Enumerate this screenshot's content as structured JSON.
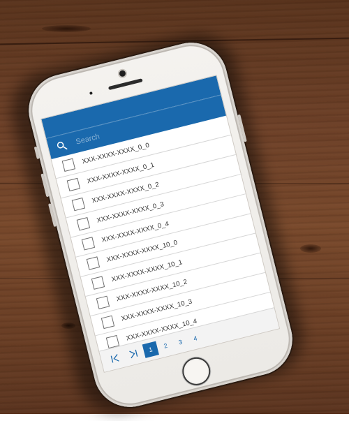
{
  "search": {
    "placeholder": "Search",
    "value": ""
  },
  "list": {
    "items": [
      {
        "label": "XXX-XXXX-XXXX_0_0",
        "checked": false
      },
      {
        "label": "XXX-XXXX-XXXX_0_1",
        "checked": false
      },
      {
        "label": "XXX-XXXX-XXXX_0_2",
        "checked": false
      },
      {
        "label": "XXX-XXXX-XXXX_0_3",
        "checked": false
      },
      {
        "label": "XXX-XXXX-XXXX_0_4",
        "checked": false
      },
      {
        "label": "XXX-XXXX-XXXX_10_0",
        "checked": false
      },
      {
        "label": "XXX-XXXX-XXXX_10_1",
        "checked": false
      },
      {
        "label": "XXX-XXXX-XXXX_10_2",
        "checked": false
      },
      {
        "label": "XXX-XXXX-XXXX_10_3",
        "checked": false
      },
      {
        "label": "XXX-XXXX-XXXX_10_4",
        "checked": false
      }
    ]
  },
  "pager": {
    "first_icon": "first-page-icon",
    "last_icon": "last-page-icon",
    "pages": [
      "1",
      "2",
      "3",
      "4"
    ],
    "current_page": "1"
  },
  "colors": {
    "accent": "#1a69ad",
    "screen_background": "#ffffff",
    "wood": "#6e4128"
  },
  "icons": {
    "search": "search-icon"
  }
}
